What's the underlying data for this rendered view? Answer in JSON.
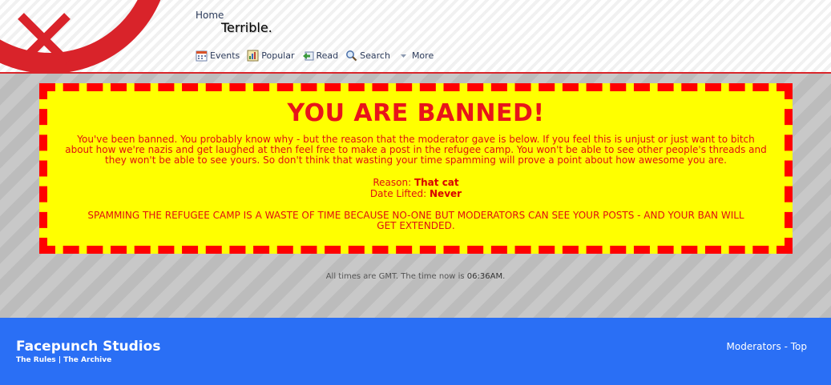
{
  "header": {
    "home_label": "Home",
    "page_title": "Terrible.",
    "nav": [
      {
        "label": "Events",
        "icon": "calendar-icon"
      },
      {
        "label": "Popular",
        "icon": "popular-icon"
      },
      {
        "label": "Read",
        "icon": "read-icon"
      },
      {
        "label": "Search",
        "icon": "search-icon"
      },
      {
        "label": "More",
        "icon": "chevron-down-icon"
      }
    ]
  },
  "ban": {
    "title": "YOU ARE BANNED!",
    "message": "You've been banned. You probably know why - but the reason that the moderator gave is below. If you feel this is unjust or just want to bitch about how we're nazis and get laughed at then feel free to make a post in the refugee camp. You won't be able to see other people's threads and they won't be able to see yours. So don't think that wasting your time spamming will prove a point about how awesome you are.",
    "reason_label": "Reason:",
    "reason_value": "That cat",
    "date_label": "Date Lifted:",
    "date_value": "Never",
    "warning": "SPAMMING THE REFUGEE CAMP IS A WASTE OF TIME BECAUSE NO-ONE BUT MODERATORS CAN SEE YOUR POSTS - AND YOUR BAN WILL GET EXTENDED."
  },
  "times": {
    "prefix": "All times are GMT. The time now is ",
    "time": "06:36AM",
    "suffix": "."
  },
  "footer": {
    "title": "Facepunch Studios",
    "rules_link": "The Rules",
    "separator": "|",
    "archive_link": "The Archive",
    "moderators_link": "Moderators",
    "dash": "-",
    "top_link": "Top"
  },
  "colors": {
    "accent_red": "#ff0000",
    "ban_background": "#ffff00",
    "footer_blue": "#2a6ff5"
  }
}
